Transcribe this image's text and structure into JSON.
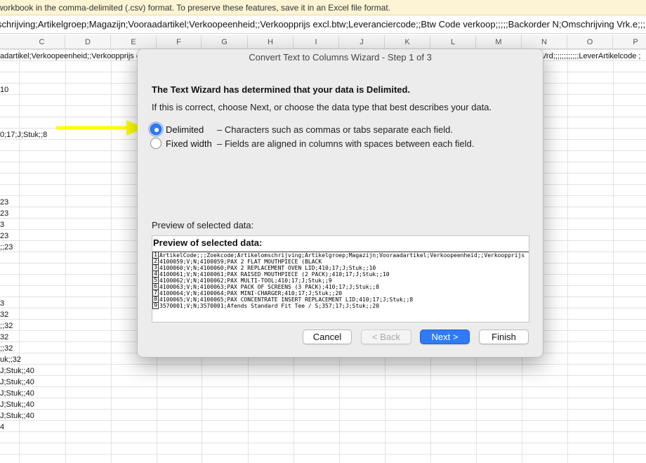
{
  "warning": {
    "text": "workbook in the comma-delimited (.csv) format. To preserve these features, save it in an Excel file format."
  },
  "formula_bar": {
    "text": "schrijving;Artikelgroep;Magazijn;Vooraadartikel;Verkoopeenheid;;Verkoopprijs excl.btw;Leveranciercode;;Btw Code verkoop;;;;;Backorder N;Omschrijving Vrk.e;;;;;"
  },
  "columns": [
    "C",
    "D",
    "E",
    "F",
    "G",
    "H",
    "I",
    "J",
    "K",
    "L",
    "M",
    "N",
    "O",
    "P"
  ],
  "sheet": {
    "row1_left": "adartikel;Verkoopeenheid;;Verkoopprijs e",
    "row1_right": "Vrd;;;;;;;;;;;;LeverArtikelcode ;",
    "cells": [
      "10",
      "0;17;J;Stuk;;8",
      "23",
      "23",
      "3",
      "23",
      ";;23",
      "3",
      "32",
      ";;32",
      "32",
      ";;32",
      "uk;;32",
      "J;Stuk;;40",
      "J;Stuk;;40",
      "J;Stuk;;40",
      "J;Stuk;;40",
      "J;Stuk;;40",
      "4"
    ]
  },
  "dialog": {
    "title": "Convert Text to Columns Wizard - Step 1 of 3",
    "heading": "The Text Wizard has determined that your data is Delimited.",
    "subheading": "If this is correct, choose Next, or choose the data type that best describes your data.",
    "options": [
      {
        "label": "Delimited",
        "desc": "– Characters such as commas or tabs separate each field.",
        "checked": true
      },
      {
        "label": "Fixed width",
        "desc": "– Fields are aligned in columns with spaces between each field.",
        "checked": false
      }
    ],
    "preview_label": "Preview of selected data:",
    "preview_title": "Preview of selected data:",
    "preview_rows": [
      {
        "n": "1",
        "text": "ArtikelCode;;;Zoekcode;Artikelomschrijving;Artikelgroep;Magazijn;Vooraadartikel;Verkoopeenheid;;Verkoopprijs"
      },
      {
        "n": "2",
        "text": "4100059;V;N;4100059;PAX 2 FLAT MOUTHPIECE (BLACK"
      },
      {
        "n": "3",
        "text": "4100060;V;N;4100060;PAX 2 REPLACEMENT OVEN LID;410;17;J;Stuk;;10"
      },
      {
        "n": "4",
        "text": "4100061;V;N;4100061;PAX RAISED MOUTHPIECE (2 PACK);410;17;J;Stuk;;10"
      },
      {
        "n": "5",
        "text": "4100062;V;N;4100062;PAX MULTI-TOOL;410;17;J;Stuk;;9"
      },
      {
        "n": "6",
        "text": "4100063;V;N;4100063;PAX PACK OF SCREENS (3 PACK);410;17;J;Stuk;;8"
      },
      {
        "n": "7",
        "text": "4100064;V;N;4100064;PAX MINI-CHARGER;410;17;J;Stuk;;20"
      },
      {
        "n": "8",
        "text": "4100065;V;N;4100065;PAX CONCENTRATE INSERT REPLACEMENT LID;410;17;J;Stuk;;8"
      },
      {
        "n": "9",
        "text": "3570001;V;N;3570001;Afends Standard Fit Tee / S;357;17;J;Stuk;;20"
      }
    ],
    "buttons": {
      "cancel": "Cancel",
      "back": "< Back",
      "next": "Next >",
      "finish": "Finish"
    }
  },
  "colors": {
    "accent": "#2f7bf5",
    "arrow": "#ffff00",
    "warning_bg": "#fcf4d4"
  }
}
